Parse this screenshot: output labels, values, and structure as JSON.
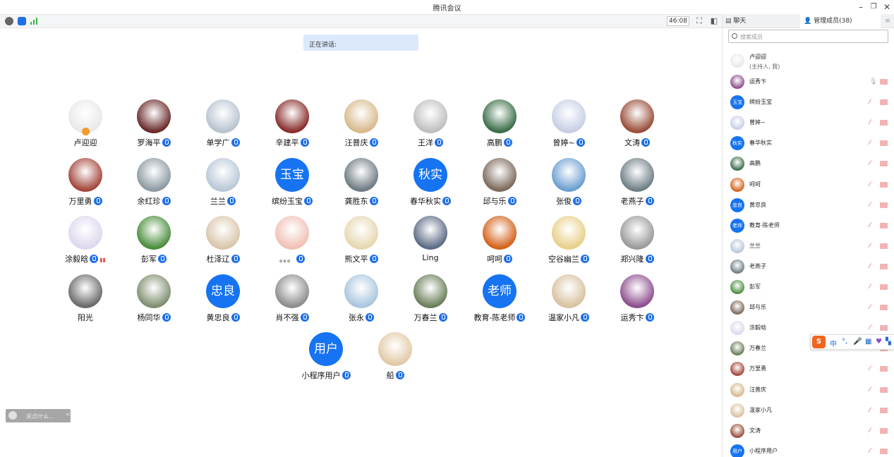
{
  "window": {
    "title": "腾讯会议",
    "controls": [
      "minimize-icon",
      "restore-icon",
      "close-icon"
    ]
  },
  "toolbar": {
    "timer": "46:08"
  },
  "speaking": {
    "label": "正在讲话:"
  },
  "participants": [
    {
      "name": "卢迎迎",
      "avatar": "photo",
      "color": "#e9e9e9",
      "host": true
    },
    {
      "name": "罗海平",
      "avatar": "photo",
      "color": "#6a2b2b",
      "mic": true
    },
    {
      "name": "单学广",
      "avatar": "photo",
      "color": "#b8c3cf",
      "mic": true
    },
    {
      "name": "辛建平",
      "avatar": "photo",
      "color": "#8a2d2d",
      "mic": true
    },
    {
      "name": "汪普庆",
      "avatar": "photo",
      "color": "#d7b98c",
      "mic": true
    },
    {
      "name": "王洋",
      "avatar": "photo",
      "color": "#bfbfbf",
      "mic": true
    },
    {
      "name": "高鹏",
      "avatar": "photo",
      "color": "#3b6e49",
      "mic": true
    },
    {
      "name": "曾婷~",
      "avatar": "photo",
      "color": "#c7cfe6",
      "mic": true
    },
    {
      "name": "文涛",
      "avatar": "photo",
      "color": "#9a4e3a",
      "mic": true
    },
    {
      "name": "万里勇",
      "avatar": "photo",
      "color": "#a4463b",
      "mic": true
    },
    {
      "name": "余红珍",
      "avatar": "photo",
      "color": "#8d9aa3",
      "mic": true
    },
    {
      "name": "兰兰",
      "avatar": "photo",
      "color": "#b9c7d7",
      "mic": true
    },
    {
      "name": "缤纷玉宝",
      "avatar": "text",
      "text": "玉宝",
      "mic": true
    },
    {
      "name": "龚胜东",
      "avatar": "photo",
      "color": "#6e7b83",
      "mic": true
    },
    {
      "name": "春华秋实",
      "avatar": "text",
      "text": "秋实",
      "mic": true
    },
    {
      "name": "邱与乐",
      "avatar": "photo",
      "color": "#7d6a5c",
      "mic": true
    },
    {
      "name": "张俊",
      "avatar": "photo",
      "color": "#6b9fd0",
      "mic": true
    },
    {
      "name": "老燕子",
      "avatar": "photo",
      "color": "#6f7f86",
      "mic": true
    },
    {
      "name": "涂毅晗",
      "avatar": "photo",
      "color": "#ded7ee",
      "mic": true,
      "signal": true
    },
    {
      "name": "彭军",
      "avatar": "photo",
      "color": "#4c8e3d",
      "mic": true
    },
    {
      "name": "杜泽辽",
      "avatar": "photo",
      "color": "#d9c6ab",
      "mic": true
    },
    {
      "name": "。。。",
      "avatar": "photo",
      "color": "#f0c0b5",
      "mic": true
    },
    {
      "name": "熊文平",
      "avatar": "photo",
      "color": "#e6d7b0",
      "mic": true
    },
    {
      "name": "Ling",
      "avatar": "photo",
      "color": "#5d6b84"
    },
    {
      "name": "呵呵",
      "avatar": "photo",
      "color": "#d4621b",
      "mic": true
    },
    {
      "name": "空谷幽兰",
      "avatar": "photo",
      "color": "#e8d08a",
      "mic": true
    },
    {
      "name": "郑兴隆",
      "avatar": "photo",
      "color": "#9a9a9a",
      "mic": true
    },
    {
      "name": "阳光",
      "avatar": "photo",
      "color": "#6b6b6b"
    },
    {
      "name": "杨同华",
      "avatar": "photo",
      "color": "#7f8f6f",
      "mic": true
    },
    {
      "name": "黄忠良",
      "avatar": "text",
      "text": "忠良",
      "mic": true
    },
    {
      "name": "肖不强",
      "avatar": "photo",
      "color": "#8d8d8d",
      "mic": true
    },
    {
      "name": "张永",
      "avatar": "photo",
      "color": "#a9c6df",
      "mic": true
    },
    {
      "name": "万春兰",
      "avatar": "photo",
      "color": "#6b7f5a",
      "mic": true
    },
    {
      "name": "教育-陈老师",
      "avatar": "text",
      "text": "老师",
      "mic": true
    },
    {
      "name": "温家小凡",
      "avatar": "photo",
      "color": "#d8c2a0",
      "mic": true
    },
    {
      "name": "运秀卞",
      "avatar": "photo",
      "color": "#8e4f8f",
      "mic": true
    },
    {
      "name": "小程序用户",
      "avatar": "text",
      "text": "用户",
      "mic": true
    },
    {
      "name": "船",
      "avatar": "photo",
      "color": "#e2c9a6",
      "mic": true
    }
  ],
  "chat_input": {
    "placeholder": "说点什么...",
    "arrow": "<"
  },
  "panel": {
    "tab_chat": "聊天",
    "tab_members": "管理成员(38)",
    "search_placeholder": "搜索成员",
    "members": [
      {
        "name": "卢迎迎",
        "role": "(主持人, 我)",
        "color": "#e9e9e9"
      },
      {
        "name": "运秀卞",
        "color": "#8e4f8f",
        "mic_active": true
      },
      {
        "name": "缤纷玉宝",
        "text": "玉宝"
      },
      {
        "name": "曾婷~",
        "color": "#c7cfe6"
      },
      {
        "name": "春华秋实",
        "text": "秋实"
      },
      {
        "name": "高鹏",
        "color": "#3b6e49"
      },
      {
        "name": "呵呵",
        "color": "#d4621b"
      },
      {
        "name": "黄忠良",
        "text": "忠良"
      },
      {
        "name": "教育-陈老师",
        "text": "老师"
      },
      {
        "name": "兰兰",
        "color": "#b9c7d7"
      },
      {
        "name": "老燕子",
        "color": "#6f7f86"
      },
      {
        "name": "彭军",
        "color": "#4c8e3d"
      },
      {
        "name": "邱与乐",
        "color": "#7d6a5c"
      },
      {
        "name": "涂毅晗",
        "color": "#ded7ee"
      },
      {
        "name": "万春兰",
        "color": "#6b7f5a"
      },
      {
        "name": "万里勇",
        "color": "#a4463b"
      },
      {
        "name": "汪普庆",
        "color": "#d7b98c"
      },
      {
        "name": "温家小凡",
        "color": "#d8c2a0"
      },
      {
        "name": "文涛",
        "color": "#9a4e3a"
      },
      {
        "name": "小程序用户",
        "text": "用户"
      }
    ]
  },
  "ime_toolbar": {
    "logo": "S",
    "lang": "中",
    "punct": "°,"
  }
}
